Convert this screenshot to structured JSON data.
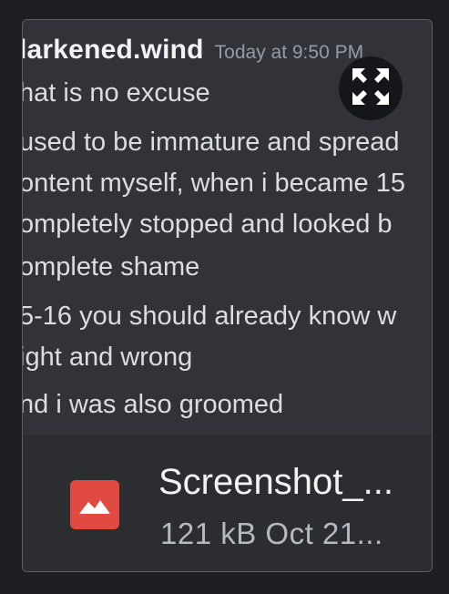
{
  "message_preview": {
    "username": "larkened.wind",
    "timestamp": "Today at 9:50 PM",
    "lines": [
      "hat is no excuse",
      "used to be immature and spread",
      "ontent myself, when i became 15",
      "ompletely stopped and looked b",
      "omplete shame",
      "5-16 you should already know w",
      "ight and wrong",
      "nd i was also groomed"
    ]
  },
  "expand_button": {
    "icon": "expand-icon"
  },
  "attachment": {
    "icon": "image-file-icon",
    "icon_color": "#e04a40",
    "file_name": "Screenshot_...",
    "file_meta": "121 kB Oct 21..."
  },
  "colors": {
    "background": "#1e1f22",
    "card": "#2b2d31",
    "preview_bg": "#313338",
    "text_primary": "#f2f3f5",
    "text_secondary": "#b5bac1",
    "timestamp": "#949ba4"
  }
}
